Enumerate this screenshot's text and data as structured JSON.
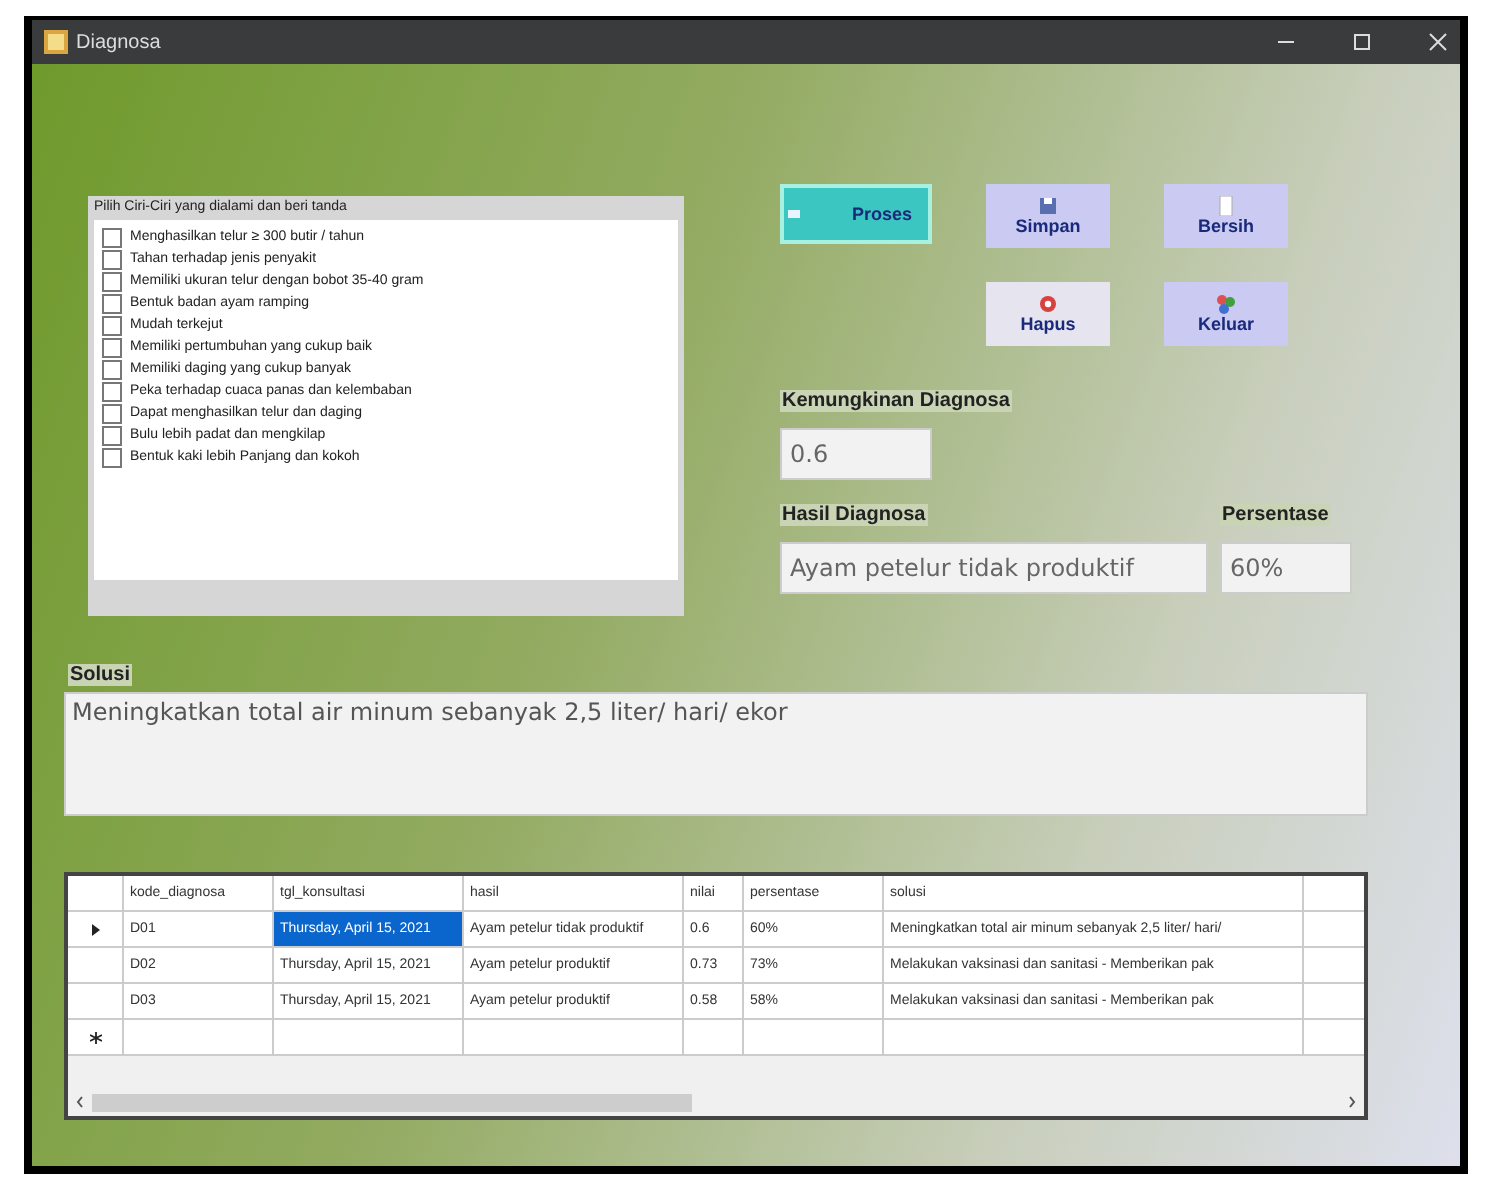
{
  "window": {
    "title": "Diagnosa"
  },
  "symptoms": {
    "title": "Pilih Ciri-Ciri yang dialami dan beri tanda",
    "items": [
      {
        "label": "Menghasilkan telur ≥ 300 butir / tahun",
        "checked": false
      },
      {
        "label": "Tahan terhadap jenis penyakit",
        "checked": false
      },
      {
        "label": "Memiliki ukuran telur dengan bobot 35-40 gram",
        "checked": false
      },
      {
        "label": "Bentuk badan ayam ramping",
        "checked": false
      },
      {
        "label": "Mudah terkejut",
        "checked": false
      },
      {
        "label": "Memiliki pertumbuhan yang cukup baik",
        "checked": false
      },
      {
        "label": "Memiliki daging yang cukup banyak",
        "checked": false
      },
      {
        "label": "Peka terhadap cuaca panas dan kelembaban",
        "checked": false
      },
      {
        "label": "Dapat menghasilkan telur dan daging",
        "checked": false
      },
      {
        "label": "Bulu lebih padat dan mengkilap",
        "checked": false
      },
      {
        "label": "Bentuk kaki lebih Panjang dan kokoh",
        "checked": false
      }
    ]
  },
  "buttons": [
    {
      "label": "Proses",
      "kind": "process"
    },
    {
      "label": "Simpan",
      "kind": "save"
    },
    {
      "label": "Bersih",
      "kind": "clear"
    },
    {
      "label": "Hapus",
      "kind": "delete"
    },
    {
      "label": "Keluar",
      "kind": "exit"
    }
  ],
  "kemungkinan": {
    "label": "Kemungkinan Diagnosa",
    "value": "0.6"
  },
  "hasil": {
    "label": "Hasil Diagnosa",
    "value": "Ayam petelur tidak produktif"
  },
  "persentase": {
    "label": "Persentase",
    "value": "60%"
  },
  "solusi": {
    "label": "Solusi",
    "value": "Meningkatkan total air minum sebanyak 2,5 liter/ hari/ ekor"
  },
  "table": {
    "columns": [
      "kode_diagnosa",
      "tgl_konsultasi",
      "hasil",
      "nilai",
      "persentase",
      "solusi"
    ],
    "rows": [
      {
        "current": true,
        "kind": "data",
        "cells": [
          {
            "text": "D01",
            "selected": false
          },
          {
            "text": "Thursday, April 15, 2021",
            "selected": true
          },
          {
            "text": "Ayam petelur tidak produktif",
            "selected": false
          },
          {
            "text": "0.6",
            "selected": false
          },
          {
            "text": "60%",
            "selected": false
          },
          {
            "text": "Meningkatkan total air minum sebanyak 2,5 liter/ hari/",
            "selected": false
          }
        ]
      },
      {
        "current": false,
        "kind": "data",
        "cells": [
          {
            "text": "D02",
            "selected": false
          },
          {
            "text": "Thursday, April 15, 2021",
            "selected": false
          },
          {
            "text": "Ayam petelur produktif",
            "selected": false
          },
          {
            "text": "0.73",
            "selected": false
          },
          {
            "text": "73%",
            "selected": false
          },
          {
            "text": "Melakukan vaksinasi dan   sanitasi - Memberikan pak",
            "selected": false
          }
        ]
      },
      {
        "current": false,
        "kind": "data",
        "cells": [
          {
            "text": "D03",
            "selected": false
          },
          {
            "text": "Thursday, April 15, 2021",
            "selected": false
          },
          {
            "text": "Ayam petelur produktif",
            "selected": false
          },
          {
            "text": "0.58",
            "selected": false
          },
          {
            "text": "58%",
            "selected": false
          },
          {
            "text": "Melakukan vaksinasi dan   sanitasi - Memberikan pak",
            "selected": false
          }
        ]
      },
      {
        "current": false,
        "kind": "new",
        "cells": []
      }
    ]
  }
}
